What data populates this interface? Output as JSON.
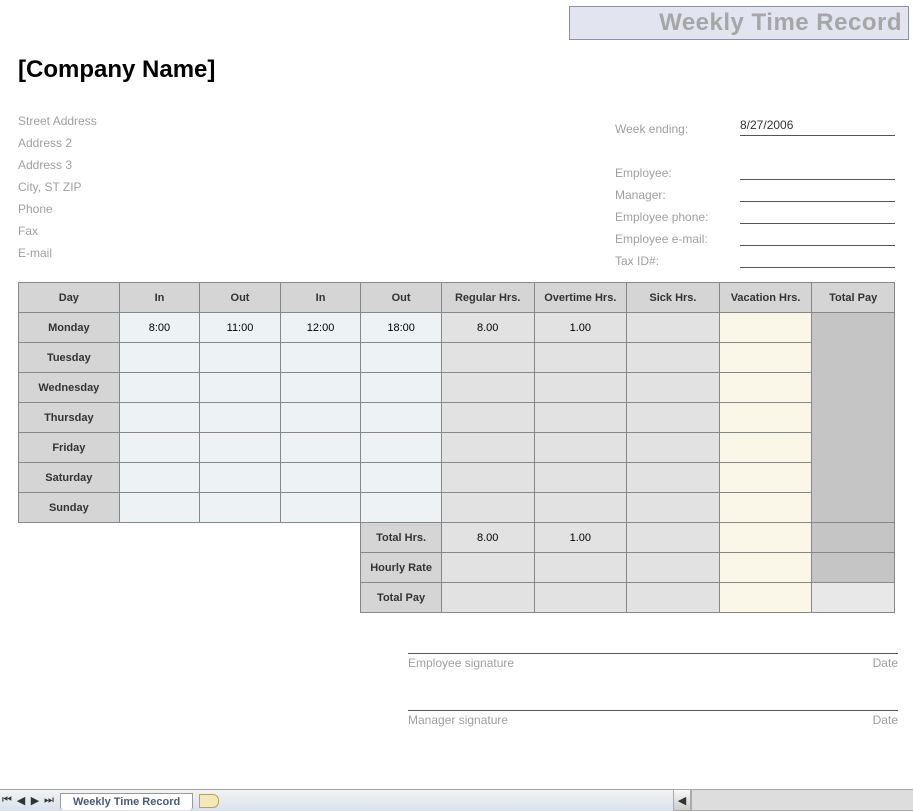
{
  "title": "Weekly Time Record",
  "company_name": "[Company Name]",
  "address": {
    "street": "Street Address",
    "line2": "Address 2",
    "line3": "Address 3",
    "city_st_zip": "City, ST  ZIP",
    "phone": "Phone",
    "fax": "Fax",
    "email": "E-mail"
  },
  "info_labels": {
    "week_ending": "Week ending:",
    "employee": "Employee:",
    "manager": "Manager:",
    "employee_phone": "Employee phone:",
    "employee_email": "Employee e-mail:",
    "tax_id": "Tax ID#:"
  },
  "info_values": {
    "week_ending": "8/27/2006",
    "employee": "",
    "manager": "",
    "employee_phone": "",
    "employee_email": "",
    "tax_id": ""
  },
  "headers": {
    "day": "Day",
    "in1": "In",
    "out1": "Out",
    "in2": "In",
    "out2": "Out",
    "regular": "Regular Hrs.",
    "overtime": "Overtime Hrs.",
    "sick": "Sick Hrs.",
    "vacation": "Vacation Hrs.",
    "total_pay": "Total Pay"
  },
  "days": [
    {
      "name": "Monday",
      "in1": "8:00",
      "out1": "11:00",
      "in2": "12:00",
      "out2": "18:00",
      "regular": "8.00",
      "overtime": "1.00",
      "sick": "",
      "vacation": ""
    },
    {
      "name": "Tuesday",
      "in1": "",
      "out1": "",
      "in2": "",
      "out2": "",
      "regular": "",
      "overtime": "",
      "sick": "",
      "vacation": ""
    },
    {
      "name": "Wednesday",
      "in1": "",
      "out1": "",
      "in2": "",
      "out2": "",
      "regular": "",
      "overtime": "",
      "sick": "",
      "vacation": ""
    },
    {
      "name": "Thursday",
      "in1": "",
      "out1": "",
      "in2": "",
      "out2": "",
      "regular": "",
      "overtime": "",
      "sick": "",
      "vacation": ""
    },
    {
      "name": "Friday",
      "in1": "",
      "out1": "",
      "in2": "",
      "out2": "",
      "regular": "",
      "overtime": "",
      "sick": "",
      "vacation": ""
    },
    {
      "name": "Saturday",
      "in1": "",
      "out1": "",
      "in2": "",
      "out2": "",
      "regular": "",
      "overtime": "",
      "sick": "",
      "vacation": ""
    },
    {
      "name": "Sunday",
      "in1": "",
      "out1": "",
      "in2": "",
      "out2": "",
      "regular": "",
      "overtime": "",
      "sick": "",
      "vacation": ""
    }
  ],
  "summary_labels": {
    "total_hrs": "Total Hrs.",
    "hourly_rate": "Hourly Rate",
    "total_pay": "Total Pay"
  },
  "summary": {
    "total_hrs": {
      "regular": "8.00",
      "overtime": "1.00",
      "sick": "",
      "vacation": ""
    },
    "hourly_rate": {
      "regular": "",
      "overtime": "",
      "sick": "",
      "vacation": ""
    },
    "total_pay": {
      "regular": "",
      "overtime": "",
      "sick": "",
      "vacation": "",
      "grand": ""
    }
  },
  "signatures": {
    "employee": "Employee signature",
    "manager": "Manager signature",
    "date": "Date"
  },
  "sheetbar": {
    "tab": "Weekly Time Record"
  }
}
